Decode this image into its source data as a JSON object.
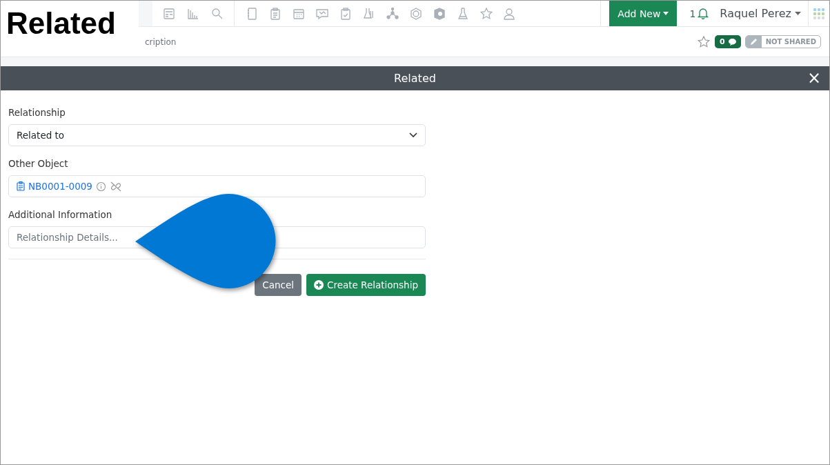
{
  "caption": "Related",
  "breadcrumb": "cription",
  "toolbar": {
    "add_new": "Add New",
    "notifications": "1",
    "user": "Raquel Perez"
  },
  "record": {
    "favorite": false,
    "comments": "0",
    "sharing": "NOT SHARED"
  },
  "dialog": {
    "title": "Related",
    "close": "×",
    "fields": [
      {
        "kind": "select",
        "label": "Relationship",
        "value": "Related to"
      },
      {
        "kind": "link",
        "label": "Other Object",
        "value": "NB0001-0009"
      },
      {
        "kind": "text",
        "label": "Additional Information",
        "placeholder": "Relationship Details..."
      }
    ],
    "buttons": [
      {
        "kind": "secondary",
        "label": "Cancel"
      },
      {
        "kind": "primary",
        "label": "Create Relationship"
      }
    ]
  }
}
